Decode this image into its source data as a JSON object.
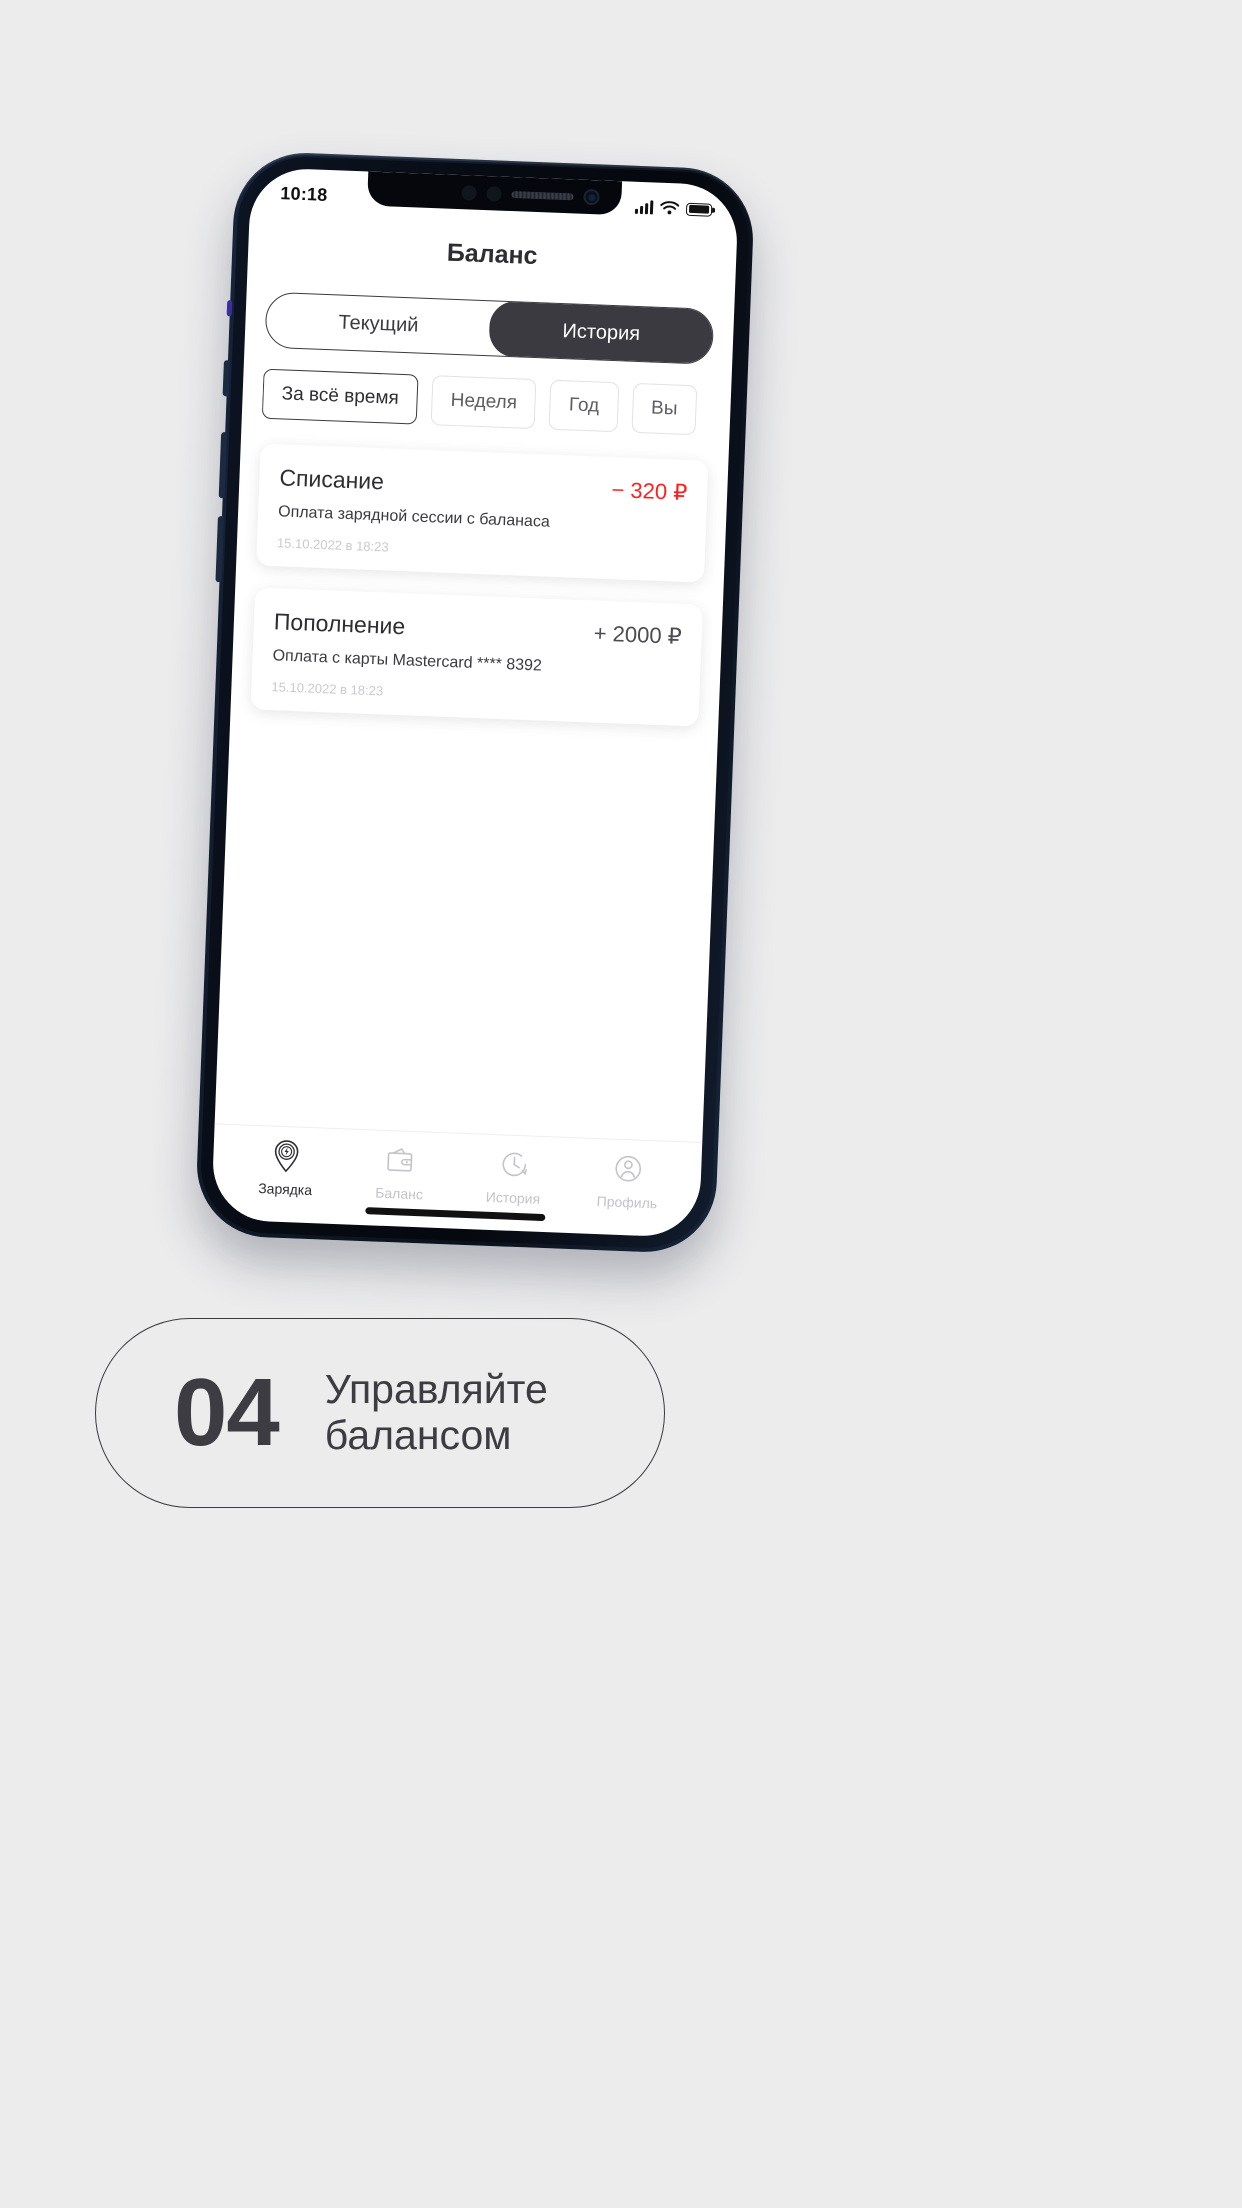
{
  "background_color": "#ececed",
  "phone": {
    "frame_color": "#101a2a",
    "statusbar": {
      "clock": "10:18",
      "signal_icon": "cellular-signal-icon",
      "wifi_icon": "wifi-icon",
      "battery_icon": "battery-icon"
    },
    "header": {
      "title": "Баланс"
    },
    "segmented": {
      "options": [
        {
          "label": "Текущий",
          "active": false
        },
        {
          "label": "История",
          "active": true
        }
      ]
    },
    "filters": {
      "chips": [
        {
          "label": "За всё время",
          "active": true
        },
        {
          "label": "Неделя",
          "active": false
        },
        {
          "label": "Год",
          "active": false
        },
        {
          "label": "Вы",
          "active": false
        }
      ]
    },
    "transactions": [
      {
        "title": "Списание",
        "amount": "− 320 ₽",
        "amount_sign": "negative",
        "description": "Оплата зарядной сессии с баланаса",
        "date": "15.10.2022 в 18:23"
      },
      {
        "title": "Пополнение",
        "amount": "+ 2000 ₽",
        "amount_sign": "positive",
        "description": "Оплата с карты Mastercard **** 8392",
        "date": "15.10.2022 в 18:23"
      }
    ],
    "tabbar": {
      "items": [
        {
          "label": "Зарядка",
          "icon": "charge-pin-icon",
          "active": true
        },
        {
          "label": "Баланс",
          "icon": "wallet-icon",
          "active": false
        },
        {
          "label": "История",
          "icon": "clock-history-icon",
          "active": false
        },
        {
          "label": "Профиль",
          "icon": "user-profile-icon",
          "active": false
        }
      ]
    }
  },
  "caption": {
    "number": "04",
    "text": "Управляйте балансом"
  },
  "colors": {
    "accent_dark": "#3a3a40",
    "negative": "#ff1f1f",
    "muted": "#c9c9cf"
  }
}
